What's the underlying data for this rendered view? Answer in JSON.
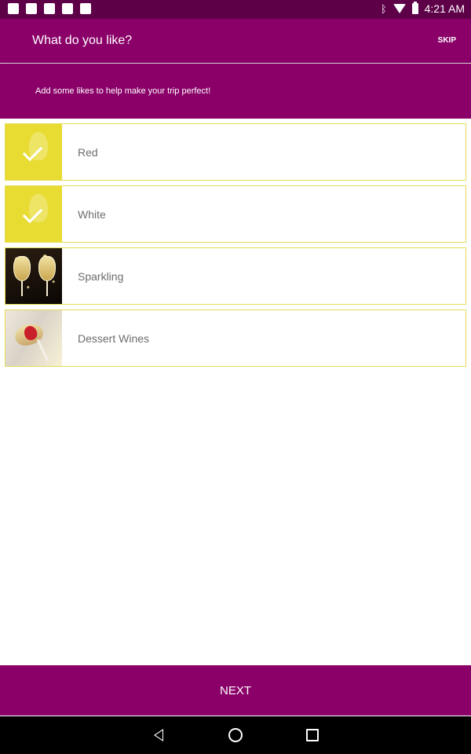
{
  "status_bar": {
    "time": "4:21 AM",
    "left_icons": [
      "facebook-icon",
      "twitter-icon",
      "phone-icon",
      "android-icon",
      "photo-icon"
    ],
    "right_icons": [
      "bluetooth-icon",
      "wifi-icon",
      "battery-icon"
    ]
  },
  "app_bar": {
    "title": "What do you like?",
    "skip_label": "SKIP"
  },
  "subheader": {
    "text": "Add some likes to help make your trip perfect!"
  },
  "items": [
    {
      "label": "Red",
      "selected": true,
      "thumbnail": "red-wine-thumbnail"
    },
    {
      "label": "White",
      "selected": true,
      "thumbnail": "white-wine-thumbnail"
    },
    {
      "label": "Sparkling",
      "selected": false,
      "thumbnail": "sparkling-wine-thumbnail"
    },
    {
      "label": "Dessert Wines",
      "selected": false,
      "thumbnail": "dessert-wine-thumbnail"
    }
  ],
  "bottom": {
    "next_label": "NEXT"
  },
  "nav_bar": {
    "buttons": [
      "back-icon",
      "home-icon",
      "recent-apps-icon"
    ]
  },
  "colors": {
    "primary": "#8a0068",
    "status_bar": "#5e0048",
    "selection_yellow": "#e8dc33",
    "border": "#e5dd55"
  }
}
